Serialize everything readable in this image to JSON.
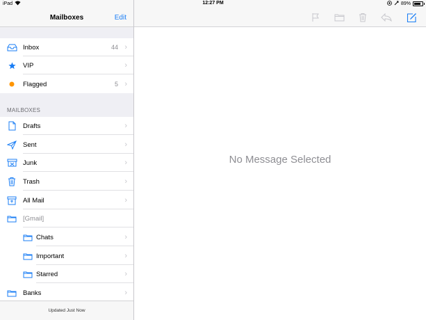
{
  "status_bar": {
    "device": "iPad",
    "time": "12:27 PM",
    "battery": "89%"
  },
  "sidebar": {
    "title": "Mailboxes",
    "edit_label": "Edit",
    "top_items": [
      {
        "label": "Inbox",
        "count": "44",
        "icon": "inbox-tray-icon"
      },
      {
        "label": "VIP",
        "count": "",
        "icon": "star-icon"
      },
      {
        "label": "Flagged",
        "count": "5",
        "icon": "orange-dot-icon"
      }
    ],
    "section_label": "MAILBOXES",
    "mailboxes": [
      {
        "label": "Drafts",
        "icon": "document-icon"
      },
      {
        "label": "Sent",
        "icon": "paper-plane-icon"
      },
      {
        "label": "Junk",
        "icon": "junk-box-icon"
      },
      {
        "label": "Trash",
        "icon": "trash-icon"
      },
      {
        "label": "All Mail",
        "icon": "archive-box-icon"
      },
      {
        "label": "[Gmail]",
        "icon": "folder-icon"
      },
      {
        "label": "Chats",
        "icon": "folder-icon"
      },
      {
        "label": "Important",
        "icon": "folder-icon"
      },
      {
        "label": "Starred",
        "icon": "folder-icon"
      },
      {
        "label": "Banks",
        "icon": "folder-icon"
      }
    ],
    "footer_text": "Updated Just Now"
  },
  "toolbar": {
    "icons": [
      "flag-icon",
      "folder-move-icon",
      "trash-icon",
      "reply-icon",
      "compose-icon"
    ],
    "disabled_color": "#c7c7cc",
    "accent_color": "#1a7ef5"
  },
  "main": {
    "empty_text": "No Message Selected"
  }
}
